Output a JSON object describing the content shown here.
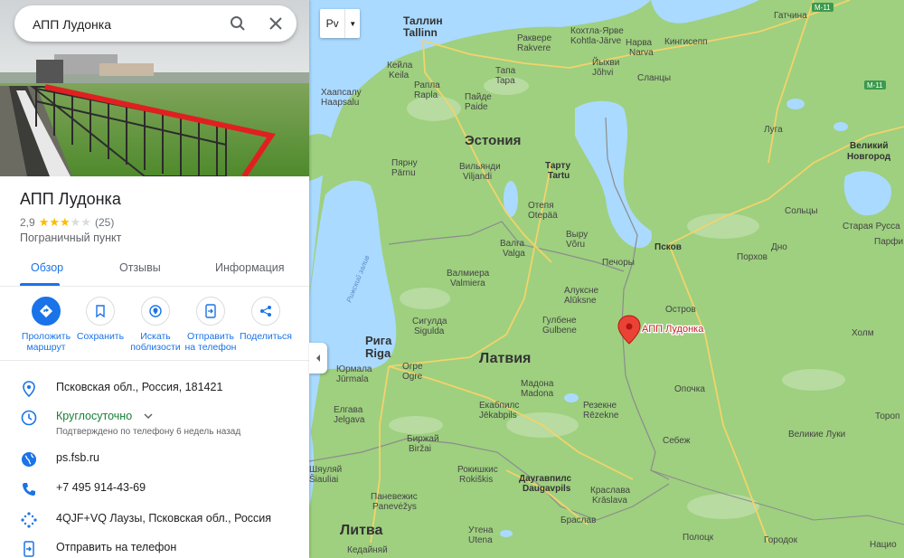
{
  "search": {
    "value": "АПП Лудонка"
  },
  "place": {
    "title": "АПП Лудонка",
    "rating_value": "2,9",
    "rating_stars": 2.9,
    "reviews_count": "(25)",
    "category": "Пограничный пункт"
  },
  "tabs": [
    {
      "label": "Обзор",
      "active": true
    },
    {
      "label": "Отзывы",
      "active": false
    },
    {
      "label": "Информация",
      "active": false
    }
  ],
  "actions": [
    {
      "label": "Проложить\nмаршрут",
      "icon": "directions-icon"
    },
    {
      "label": "Сохранить",
      "icon": "bookmark-icon"
    },
    {
      "label": "Искать\nпоблизости",
      "icon": "nearby-icon"
    },
    {
      "label": "Отправить\nна телефон",
      "icon": "send-to-phone-icon"
    },
    {
      "label": "Поделиться",
      "icon": "share-icon"
    }
  ],
  "info": {
    "address": "Псковская обл., Россия, 181421",
    "hours": "Круглосуточно",
    "hours_note": "Подтверждено по телефону 6 недель назад",
    "website": "ps.fsb.ru",
    "phone": "+7 495 914-43-69",
    "plus_code": "4QJF+VQ Лаузы, Псковская обл., Россия",
    "send_to_phone": "Отправить на телефон"
  },
  "map": {
    "layer_button": "Рv",
    "marker_label": "АПП Лудонка",
    "labels": {
      "tallinn": "Таллин",
      "tallinn_en": "Tallinn",
      "keila": "Кейла",
      "keila_en": "Keila",
      "rakvere": "Раквере",
      "rakvere_en": "Rakvere",
      "kohtla": "Кохтла-Ярве",
      "kohtla_en": "Kohtla-Järve",
      "narva": "Нарва",
      "narva_en": "Narva",
      "kingisepp": "Кингисепп",
      "gatchina": "Гатчина",
      "jyhvi": "Йыхви",
      "jyhvi_en": "Jõhvi",
      "slantsy": "Сланцы",
      "tapa": "Тапа",
      "tapa_en": "Tapa",
      "rapla": "Рапла",
      "rapla_en": "Rapla",
      "haapsalu": "Хаапсалу",
      "haapsalu_en": "Haapsalu",
      "paide": "Пайде",
      "paide_en": "Paide",
      "estonia": "Эстония",
      "luga": "Луга",
      "novgorod1": "Великий",
      "novgorod2": "Новгород",
      "parnu": "Пярну",
      "parnu_en": "Pärnu",
      "viljandi": "Вильянди",
      "viljandi_en": "Viljandi",
      "tartu": "Тарту",
      "tartu_en": "Tartu",
      "otepaa": "Отепя",
      "otepaa_en": "Otepää",
      "soltsy": "Сольцы",
      "staraya": "Старая Русса",
      "valga": "Валга",
      "valga_en": "Valga",
      "voru": "Выру",
      "voru_en": "Võru",
      "pskov": "Псков",
      "dno": "Дно",
      "porhov": "Порхов",
      "parfino": "Парфи",
      "pechory": "Печоры",
      "valmiera": "Валмиера",
      "valmiera_en": "Valmiera",
      "aluksne": "Алуксне",
      "aluksne_en": "Alūksne",
      "gulf": "Рижский залив",
      "ostrov": "Остров",
      "sigulda": "Сигулда",
      "sigulda_en": "Sigulda",
      "gulbene": "Гулбене",
      "gulbene_en": "Gulbene",
      "holm": "Холм",
      "riga": "Рига",
      "riga_en": "Riga",
      "jurmala": "Юрмала",
      "jurmala_en": "Jūrmala",
      "ogre": "Огре",
      "ogre_en": "Ogre",
      "latvia": "Латвия",
      "madona": "Мадона",
      "madona_en": "Madona",
      "opochka": "Опочка",
      "jelgava": "Елгава",
      "jelgava_en": "Jelgava",
      "jekabpils": "Екабпилс",
      "jekabpils_en": "Jēkabpils",
      "rezekne": "Резекне",
      "rezekne_en": "Rēzekne",
      "toropets": "Тороп",
      "birzai": "Биржай",
      "birzai_en": "Biržai",
      "sebezh": "Себеж",
      "velikie": "Великие Луки",
      "siauliai": "Шяуляй",
      "siauliai_en": "Šiauliai",
      "rokiskis": "Рокишкис",
      "rokiskis_en": "Rokiškis",
      "daugavpils": "Даугавпилс",
      "daugavpils_en": "Daugavpils",
      "kraslava": "Краслава",
      "kraslava_en": "Krāslava",
      "panevezys": "Паневежис",
      "panevezys_en": "Panevėžys",
      "braslav": "Браслав",
      "lithuania": "Литва",
      "utena": "Утена",
      "utena_en": "Utena",
      "kedainiai": "Кедайняй",
      "polotsk": "Полоцк",
      "gorodok": "Городок",
      "nacio": "Нацио",
      "m11a": "M-11",
      "m11b": "M-11"
    }
  }
}
